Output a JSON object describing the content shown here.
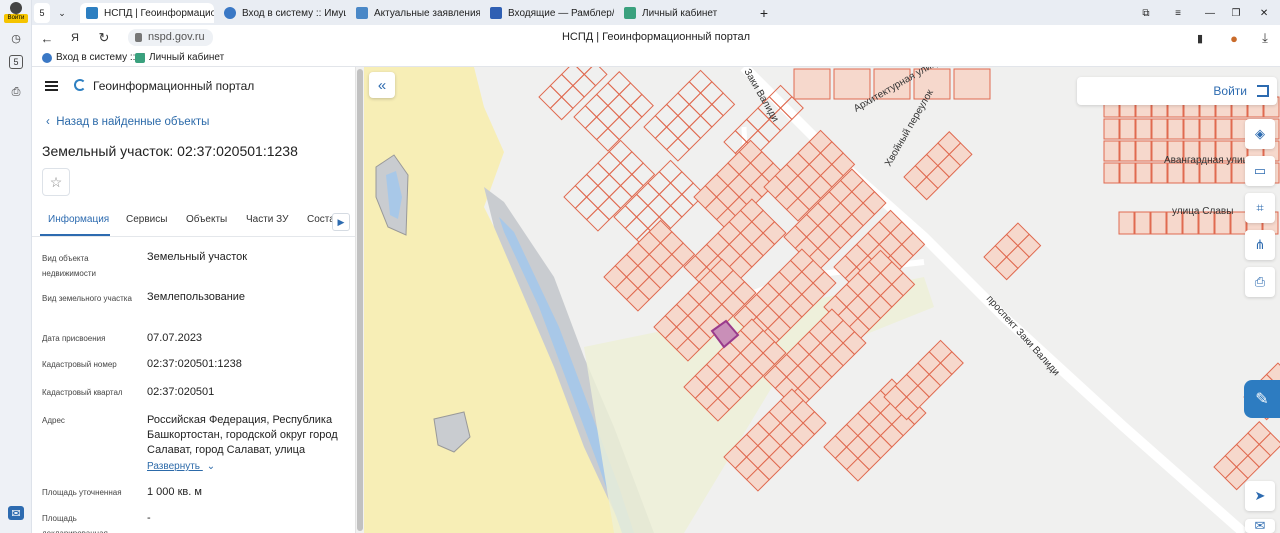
{
  "browser": {
    "profile_badge": "Войти",
    "tabs": [
      {
        "label": "НСПД | Геоинформацио",
        "active": true
      },
      {
        "label": "Вход в систему :: Имущес",
        "active": false
      },
      {
        "label": "Актуальные заявления",
        "active": false
      },
      {
        "label": "Входящие — Рамблер/по",
        "active": false
      },
      {
        "label": "Личный кабинет",
        "active": false
      }
    ],
    "url": "nspd.gov.ru",
    "page_title": "НСПД | Геоинформационный портал",
    "bookmarks": [
      "Вход в систему :: И",
      "Личный кабинет"
    ],
    "rail_counter": "5"
  },
  "panel": {
    "portal_name": "Геоинформационный портал",
    "back_link": "Назад в найденные объекты",
    "title": "Земельный участок: 02:37:020501:1238",
    "tabs": [
      "Информация",
      "Сервисы",
      "Объекты",
      "Части ЗУ",
      "Соста"
    ],
    "properties": [
      {
        "label": "Вид объекта недвижимости",
        "value": "Земельный участок"
      },
      {
        "label": "Вид земельного участка",
        "value": "Землепользование"
      },
      {
        "label": "Дата присвоения",
        "value": "07.07.2023"
      },
      {
        "label": "Кадастровый номер",
        "value": "02:37:020501:1238"
      },
      {
        "label": "Кадастровый квартал",
        "value": "02:37:020501"
      },
      {
        "label": "Адрес",
        "value": "Российская Федерация, Республика Башкортостан, городской округ город Салават, город Салават, улица"
      },
      {
        "label": "Площадь уточненная",
        "value": "1 000 кв. м"
      },
      {
        "label": "Площадь декларированная",
        "value": "-"
      }
    ],
    "expand_link": "Развернуть"
  },
  "map": {
    "login_label": "Войти",
    "street_labels": [
      "Заки Валиди",
      "Архитектурная улица",
      "Хвойный переулок",
      "Авангардная улица",
      "улица Славы",
      "проспект Заки Валиди"
    ],
    "colors": {
      "parcel_stroke": "#e06a50",
      "parcel_fill": "#f6d8cc",
      "selected": "#9a3b8c",
      "water": "#a8c8e8",
      "sand": "#f7eeb6",
      "accent": "#2d6bb0"
    }
  }
}
